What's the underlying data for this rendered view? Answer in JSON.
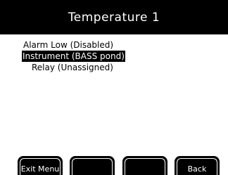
{
  "header": {
    "title": "Temperature 1"
  },
  "menu": {
    "items": [
      {
        "label": "Alarm Low (Disabled)",
        "selected": false
      },
      {
        "label": "Instrument (BASS pond)",
        "selected": true
      },
      {
        "label": "Relay (Unassigned)",
        "selected": false
      }
    ]
  },
  "softkeys": {
    "key1": "Exit Menu",
    "key2": "",
    "key3": "",
    "key4": "Back"
  }
}
